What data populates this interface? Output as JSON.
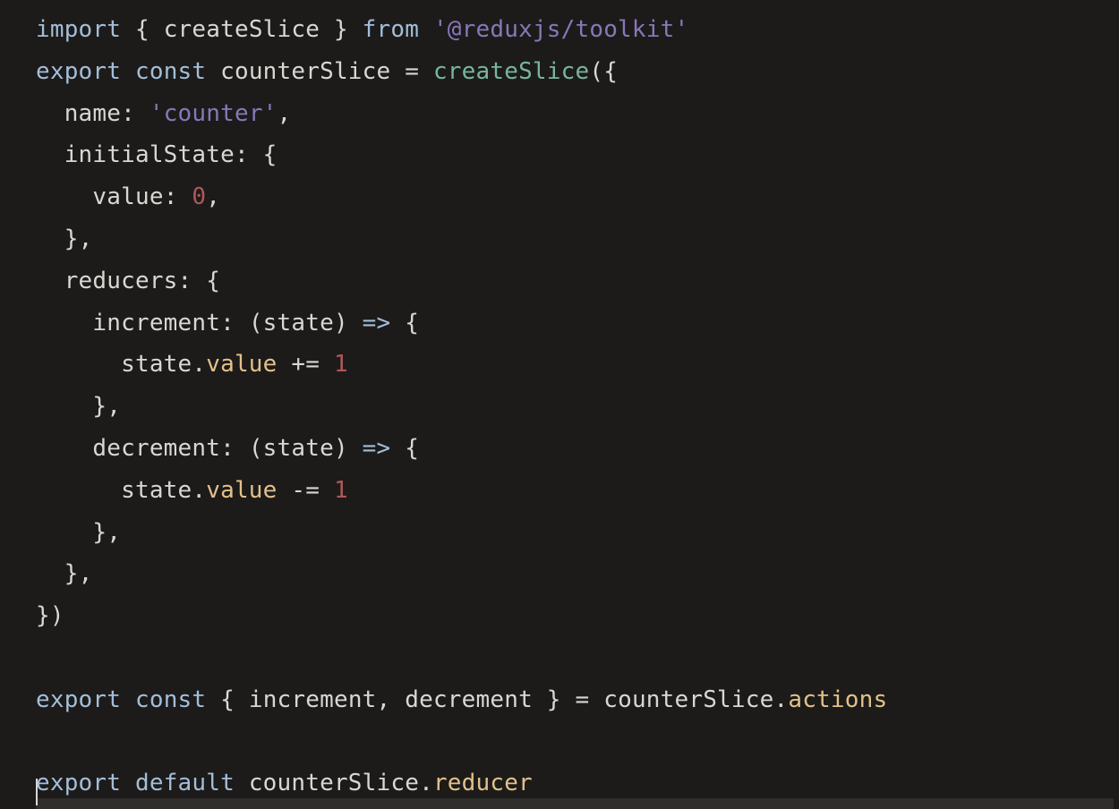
{
  "code": {
    "tokens": [
      [
        {
          "t": "import",
          "c": "tok-kw"
        },
        {
          "t": " ",
          "c": "tok-pun"
        },
        {
          "t": "{",
          "c": "tok-pun"
        },
        {
          "t": " ",
          "c": "tok-pun"
        },
        {
          "t": "createSlice",
          "c": "tok-id"
        },
        {
          "t": " ",
          "c": "tok-pun"
        },
        {
          "t": "}",
          "c": "tok-pun"
        },
        {
          "t": " ",
          "c": "tok-pun"
        },
        {
          "t": "from",
          "c": "tok-kw"
        },
        {
          "t": " ",
          "c": "tok-pun"
        },
        {
          "t": "'@reduxjs/toolkit'",
          "c": "tok-str"
        }
      ],
      [
        {
          "t": "export",
          "c": "tok-kw"
        },
        {
          "t": " ",
          "c": "tok-pun"
        },
        {
          "t": "const",
          "c": "tok-kw"
        },
        {
          "t": " ",
          "c": "tok-pun"
        },
        {
          "t": "counterSlice",
          "c": "tok-id"
        },
        {
          "t": " ",
          "c": "tok-pun"
        },
        {
          "t": "=",
          "c": "tok-pun"
        },
        {
          "t": " ",
          "c": "tok-pun"
        },
        {
          "t": "createSlice",
          "c": "tok-fn"
        },
        {
          "t": "(",
          "c": "tok-pun"
        },
        {
          "t": "{",
          "c": "tok-pun"
        }
      ],
      [
        {
          "t": "  name",
          "c": "tok-id"
        },
        {
          "t": ":",
          "c": "tok-pun"
        },
        {
          "t": " ",
          "c": "tok-pun"
        },
        {
          "t": "'counter'",
          "c": "tok-str"
        },
        {
          "t": ",",
          "c": "tok-pun"
        }
      ],
      [
        {
          "t": "  initialState",
          "c": "tok-id"
        },
        {
          "t": ":",
          "c": "tok-pun"
        },
        {
          "t": " ",
          "c": "tok-pun"
        },
        {
          "t": "{",
          "c": "tok-pun"
        }
      ],
      [
        {
          "t": "    value",
          "c": "tok-id"
        },
        {
          "t": ":",
          "c": "tok-pun"
        },
        {
          "t": " ",
          "c": "tok-pun"
        },
        {
          "t": "0",
          "c": "tok-num"
        },
        {
          "t": ",",
          "c": "tok-pun"
        }
      ],
      [
        {
          "t": "  }",
          "c": "tok-pun"
        },
        {
          "t": ",",
          "c": "tok-pun"
        }
      ],
      [
        {
          "t": "  reducers",
          "c": "tok-id"
        },
        {
          "t": ":",
          "c": "tok-pun"
        },
        {
          "t": " ",
          "c": "tok-pun"
        },
        {
          "t": "{",
          "c": "tok-pun"
        }
      ],
      [
        {
          "t": "    increment",
          "c": "tok-id"
        },
        {
          "t": ":",
          "c": "tok-pun"
        },
        {
          "t": " ",
          "c": "tok-pun"
        },
        {
          "t": "(",
          "c": "tok-pun"
        },
        {
          "t": "state",
          "c": "tok-id"
        },
        {
          "t": ")",
          "c": "tok-pun"
        },
        {
          "t": " ",
          "c": "tok-pun"
        },
        {
          "t": "=>",
          "c": "tok-arrow"
        },
        {
          "t": " ",
          "c": "tok-pun"
        },
        {
          "t": "{",
          "c": "tok-pun"
        }
      ],
      [
        {
          "t": "      state",
          "c": "tok-id"
        },
        {
          "t": ".",
          "c": "tok-pun"
        },
        {
          "t": "value",
          "c": "tok-prop"
        },
        {
          "t": " ",
          "c": "tok-pun"
        },
        {
          "t": "+=",
          "c": "tok-pun"
        },
        {
          "t": " ",
          "c": "tok-pun"
        },
        {
          "t": "1",
          "c": "tok-num"
        }
      ],
      [
        {
          "t": "    }",
          "c": "tok-pun"
        },
        {
          "t": ",",
          "c": "tok-pun"
        }
      ],
      [
        {
          "t": "    decrement",
          "c": "tok-id"
        },
        {
          "t": ":",
          "c": "tok-pun"
        },
        {
          "t": " ",
          "c": "tok-pun"
        },
        {
          "t": "(",
          "c": "tok-pun"
        },
        {
          "t": "state",
          "c": "tok-id"
        },
        {
          "t": ")",
          "c": "tok-pun"
        },
        {
          "t": " ",
          "c": "tok-pun"
        },
        {
          "t": "=>",
          "c": "tok-arrow"
        },
        {
          "t": " ",
          "c": "tok-pun"
        },
        {
          "t": "{",
          "c": "tok-pun"
        }
      ],
      [
        {
          "t": "      state",
          "c": "tok-id"
        },
        {
          "t": ".",
          "c": "tok-pun"
        },
        {
          "t": "value",
          "c": "tok-prop"
        },
        {
          "t": " ",
          "c": "tok-pun"
        },
        {
          "t": "-=",
          "c": "tok-pun"
        },
        {
          "t": " ",
          "c": "tok-pun"
        },
        {
          "t": "1",
          "c": "tok-num"
        }
      ],
      [
        {
          "t": "    }",
          "c": "tok-pun"
        },
        {
          "t": ",",
          "c": "tok-pun"
        }
      ],
      [
        {
          "t": "  }",
          "c": "tok-pun"
        },
        {
          "t": ",",
          "c": "tok-pun"
        }
      ],
      [
        {
          "t": "}",
          "c": "tok-pun"
        },
        {
          "t": ")",
          "c": "tok-pun"
        }
      ],
      [
        {
          "t": "",
          "c": "tok-pun"
        }
      ],
      [
        {
          "t": "export",
          "c": "tok-kw"
        },
        {
          "t": " ",
          "c": "tok-pun"
        },
        {
          "t": "const",
          "c": "tok-kw"
        },
        {
          "t": " ",
          "c": "tok-pun"
        },
        {
          "t": "{",
          "c": "tok-pun"
        },
        {
          "t": " ",
          "c": "tok-pun"
        },
        {
          "t": "increment",
          "c": "tok-id"
        },
        {
          "t": ",",
          "c": "tok-pun"
        },
        {
          "t": " ",
          "c": "tok-pun"
        },
        {
          "t": "decrement",
          "c": "tok-id"
        },
        {
          "t": " ",
          "c": "tok-pun"
        },
        {
          "t": "}",
          "c": "tok-pun"
        },
        {
          "t": " ",
          "c": "tok-pun"
        },
        {
          "t": "=",
          "c": "tok-pun"
        },
        {
          "t": " ",
          "c": "tok-pun"
        },
        {
          "t": "counterSlice",
          "c": "tok-id"
        },
        {
          "t": ".",
          "c": "tok-pun"
        },
        {
          "t": "actions",
          "c": "tok-prop"
        }
      ],
      [
        {
          "t": "",
          "c": "tok-pun"
        }
      ],
      [
        {
          "t": "export",
          "c": "tok-kw"
        },
        {
          "t": " ",
          "c": "tok-pun"
        },
        {
          "t": "default",
          "c": "tok-kw"
        },
        {
          "t": " ",
          "c": "tok-pun"
        },
        {
          "t": "counterSlice",
          "c": "tok-id"
        },
        {
          "t": ".",
          "c": "tok-pun"
        },
        {
          "t": "reducer",
          "c": "tok-prop"
        }
      ]
    ]
  }
}
